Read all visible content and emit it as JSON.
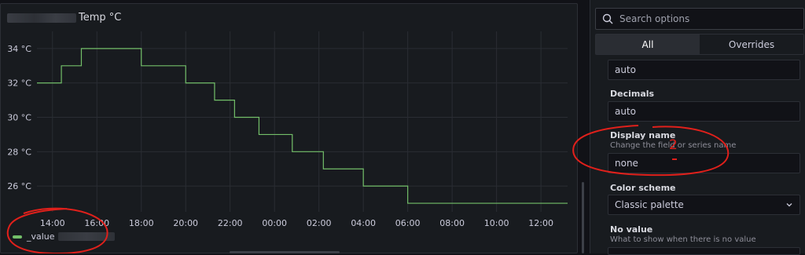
{
  "panel": {
    "title": "Temp °C",
    "legend_label": "_value"
  },
  "chart_data": {
    "type": "line",
    "title": "Temp °C",
    "y_unit": "°C",
    "ylim": [
      24.5,
      35
    ],
    "y_ticks": [
      "34 °C",
      "32 °C",
      "30 °C",
      "28 °C",
      "26 °C"
    ],
    "y_tick_values": [
      34,
      32,
      30,
      28,
      26
    ],
    "x_ticks": [
      "14:00",
      "16:00",
      "18:00",
      "20:00",
      "22:00",
      "00:00",
      "02:00",
      "04:00",
      "06:00",
      "08:00",
      "10:00",
      "12:00"
    ],
    "x_start_hour": 13.3,
    "x_end_hour": 37.2,
    "grid": true,
    "series": [
      {
        "name": "_value",
        "color": "#73bf69",
        "step_points": [
          [
            13.3,
            32
          ],
          [
            14.4,
            33
          ],
          [
            15.3,
            34
          ],
          [
            18.0,
            33
          ],
          [
            20.0,
            32
          ],
          [
            21.3,
            31
          ],
          [
            22.2,
            30
          ],
          [
            23.3,
            29
          ],
          [
            24.8,
            28
          ],
          [
            26.2,
            27
          ],
          [
            28.0,
            26
          ],
          [
            30.0,
            25
          ],
          [
            37.2,
            25
          ]
        ]
      }
    ]
  },
  "options": {
    "search_placeholder": "Search options",
    "tabs": [
      "All",
      "Overrides"
    ],
    "unit_value": "auto",
    "decimals_label": "Decimals",
    "decimals_value": "auto",
    "display_name_label": "Display name",
    "display_name_desc": "Change the field or series name",
    "display_name_value": "none",
    "color_scheme_label": "Color scheme",
    "color_scheme_value": "Classic palette",
    "no_value_label": "No value",
    "no_value_desc": "What to show when there is no value"
  },
  "annotations": {
    "number_mark": "2",
    "color": "#e0201b"
  }
}
